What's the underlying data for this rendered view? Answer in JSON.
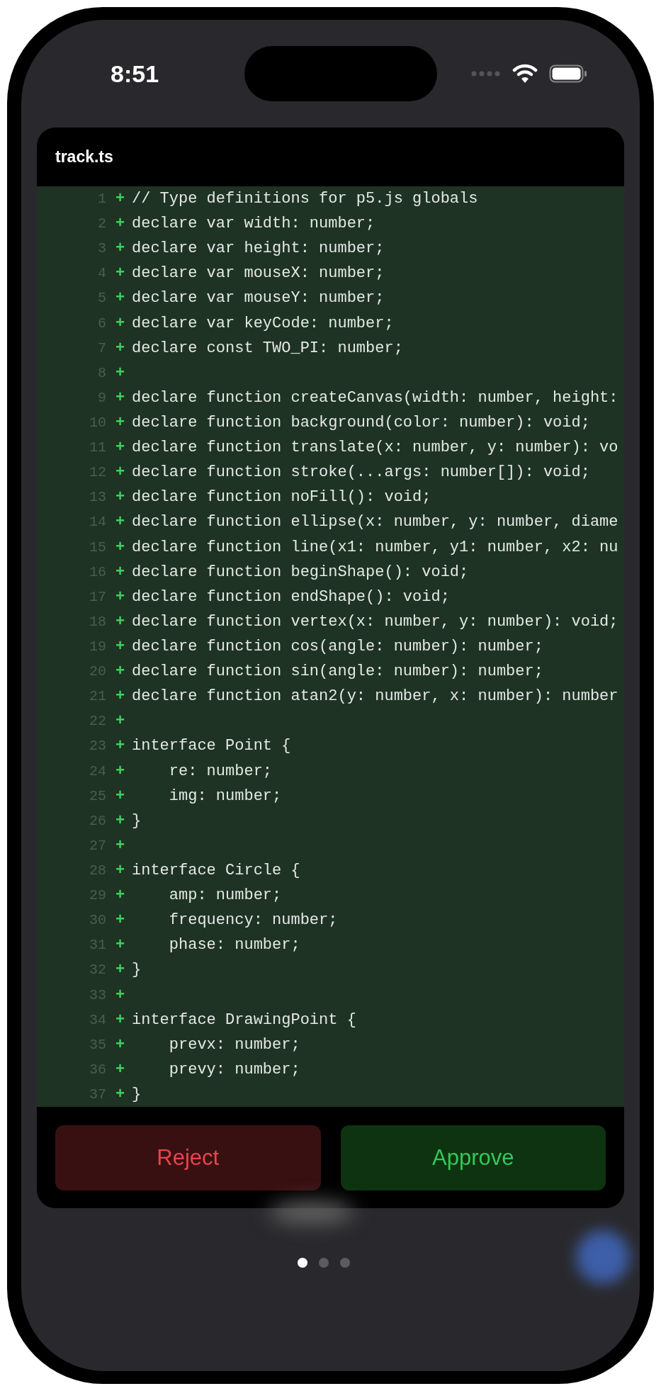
{
  "status_bar": {
    "time": "8:51"
  },
  "file": {
    "title": "track.ts"
  },
  "diff_lines": [
    {
      "number": "1",
      "marker": "+",
      "kind": "added",
      "text": "// Type definitions for p5.js globals"
    },
    {
      "number": "2",
      "marker": "+",
      "kind": "added",
      "text": "declare var width: number;"
    },
    {
      "number": "3",
      "marker": "+",
      "kind": "added",
      "text": "declare var height: number;"
    },
    {
      "number": "4",
      "marker": "+",
      "kind": "added",
      "text": "declare var mouseX: number;"
    },
    {
      "number": "5",
      "marker": "+",
      "kind": "added",
      "text": "declare var mouseY: number;"
    },
    {
      "number": "6",
      "marker": "+",
      "kind": "added",
      "text": "declare var keyCode: number;"
    },
    {
      "number": "7",
      "marker": "+",
      "kind": "added",
      "text": "declare const TWO_PI: number;"
    },
    {
      "number": "8",
      "marker": "+",
      "kind": "added"
    },
    {
      "number": "9",
      "marker": "+",
      "kind": "added",
      "text": "declare function createCanvas(width: number, height:"
    },
    {
      "number": "10",
      "marker": "+",
      "kind": "added",
      "text": "declare function background(color: number): void;"
    },
    {
      "number": "11",
      "marker": "+",
      "kind": "added",
      "text": "declare function translate(x: number, y: number): vo"
    },
    {
      "number": "12",
      "marker": "+",
      "kind": "added",
      "text": "declare function stroke(...args: number[]): void;"
    },
    {
      "number": "13",
      "marker": "+",
      "kind": "added",
      "text": "declare function noFill(): void;"
    },
    {
      "number": "14",
      "marker": "+",
      "kind": "added",
      "text": "declare function ellipse(x: number, y: number, diame"
    },
    {
      "number": "15",
      "marker": "+",
      "kind": "added",
      "text": "declare function line(x1: number, y1: number, x2: nu"
    },
    {
      "number": "16",
      "marker": "+",
      "kind": "added",
      "text": "declare function beginShape(): void;"
    },
    {
      "number": "17",
      "marker": "+",
      "kind": "added",
      "text": "declare function endShape(): void;"
    },
    {
      "number": "18",
      "marker": "+",
      "kind": "added",
      "text": "declare function vertex(x: number, y: number): void;"
    },
    {
      "number": "19",
      "marker": "+",
      "kind": "added",
      "text": "declare function cos(angle: number): number;"
    },
    {
      "number": "20",
      "marker": "+",
      "kind": "added",
      "text": "declare function sin(angle: number): number;"
    },
    {
      "number": "21",
      "marker": "+",
      "kind": "added",
      "text": "declare function atan2(y: number, x: number): number"
    },
    {
      "number": "22",
      "marker": "+",
      "kind": "added"
    },
    {
      "number": "23",
      "marker": "+",
      "kind": "added",
      "text": "interface Point {"
    },
    {
      "number": "24",
      "marker": "+",
      "kind": "added",
      "text": "    re: number;"
    },
    {
      "number": "25",
      "marker": "+",
      "kind": "added",
      "text": "    img: number;"
    },
    {
      "number": "26",
      "marker": "+",
      "kind": "added",
      "text": "}"
    },
    {
      "number": "27",
      "marker": "+",
      "kind": "added"
    },
    {
      "number": "28",
      "marker": "+",
      "kind": "added",
      "text": "interface Circle {"
    },
    {
      "number": "29",
      "marker": "+",
      "kind": "added",
      "text": "    amp: number;"
    },
    {
      "number": "30",
      "marker": "+",
      "kind": "added",
      "text": "    frequency: number;"
    },
    {
      "number": "31",
      "marker": "+",
      "kind": "added",
      "text": "    phase: number;"
    },
    {
      "number": "32",
      "marker": "+",
      "kind": "added",
      "text": "}"
    },
    {
      "number": "33",
      "marker": "+",
      "kind": "added"
    },
    {
      "number": "34",
      "marker": "+",
      "kind": "added",
      "text": "interface DrawingPoint {"
    },
    {
      "number": "35",
      "marker": "+",
      "kind": "added",
      "text": "    prevx: number;"
    },
    {
      "number": "36",
      "marker": "+",
      "kind": "added",
      "text": "    prevy: number;"
    },
    {
      "number": "37",
      "marker": "+",
      "kind": "added",
      "text": "}"
    }
  ],
  "buttons": [
    {
      "label": "Reject",
      "kind": "reject"
    },
    {
      "label": "Approve",
      "kind": "approve"
    }
  ],
  "page_dots": [
    {
      "selected": true
    },
    {
      "selected": false
    },
    {
      "selected": false
    }
  ]
}
